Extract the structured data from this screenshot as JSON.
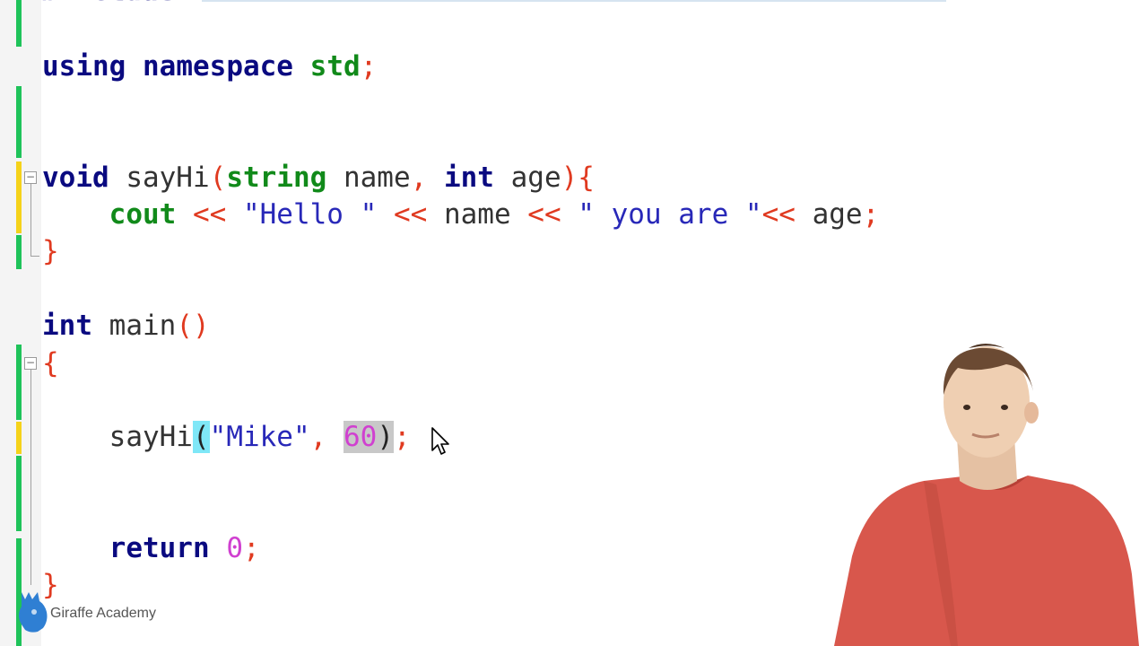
{
  "editor": {
    "lines": [
      {
        "id": "using",
        "tokens": {
          "t1": "using",
          "t2": " ",
          "t3": "namespace",
          "t4": " ",
          "t5": "std",
          "t6": ";"
        }
      },
      {
        "id": "func-decl",
        "tokens": {
          "t1": "void",
          "t2": " sayHi",
          "t3": "(",
          "t4": "string",
          "t5": " name",
          "t6": ",",
          "t7": " ",
          "t8": "int",
          "t9": " age",
          "t10": ")",
          "t11": "{"
        }
      },
      {
        "id": "cout",
        "tokens": {
          "t1": "    ",
          "t2": "cout",
          "t3": " ",
          "t4": "<<",
          "t5": " ",
          "t6": "\"Hello \"",
          "t7": " ",
          "t8": "<<",
          "t9": " name ",
          "t10": "<<",
          "t11": " ",
          "t12": "\" you are \"",
          "t13": "<<",
          "t14": " age",
          "t15": ";"
        }
      },
      {
        "id": "func-close",
        "tokens": {
          "t1": "}"
        }
      },
      {
        "id": "main-decl",
        "tokens": {
          "t1": "int",
          "t2": " main",
          "t3": "()"
        }
      },
      {
        "id": "main-open",
        "tokens": {
          "t1": "{"
        }
      },
      {
        "id": "call",
        "tokens": {
          "t1": "    sayHi",
          "t2": "(",
          "t3": "\"Mike\"",
          "t4": ",",
          "t5": " ",
          "t6": "60",
          "t7": ")",
          "t8": ";"
        }
      },
      {
        "id": "return",
        "tokens": {
          "t1": "    ",
          "t2": "return",
          "t3": " ",
          "t4": "0",
          "t5": ";"
        }
      },
      {
        "id": "main-close",
        "tokens": {
          "t1": "}"
        }
      }
    ],
    "include_hint": "#include",
    "colors": {
      "keyword": "#0a0a80",
      "type": "#118a1a",
      "punctuation": "#e03a20",
      "string": "#2828b8",
      "number": "#d040d0",
      "change_saved": "#1fc35a",
      "change_unsaved": "#f5d21a"
    }
  },
  "brand": {
    "name": "Giraffe Academy",
    "logo_icon": "giraffe-icon"
  }
}
